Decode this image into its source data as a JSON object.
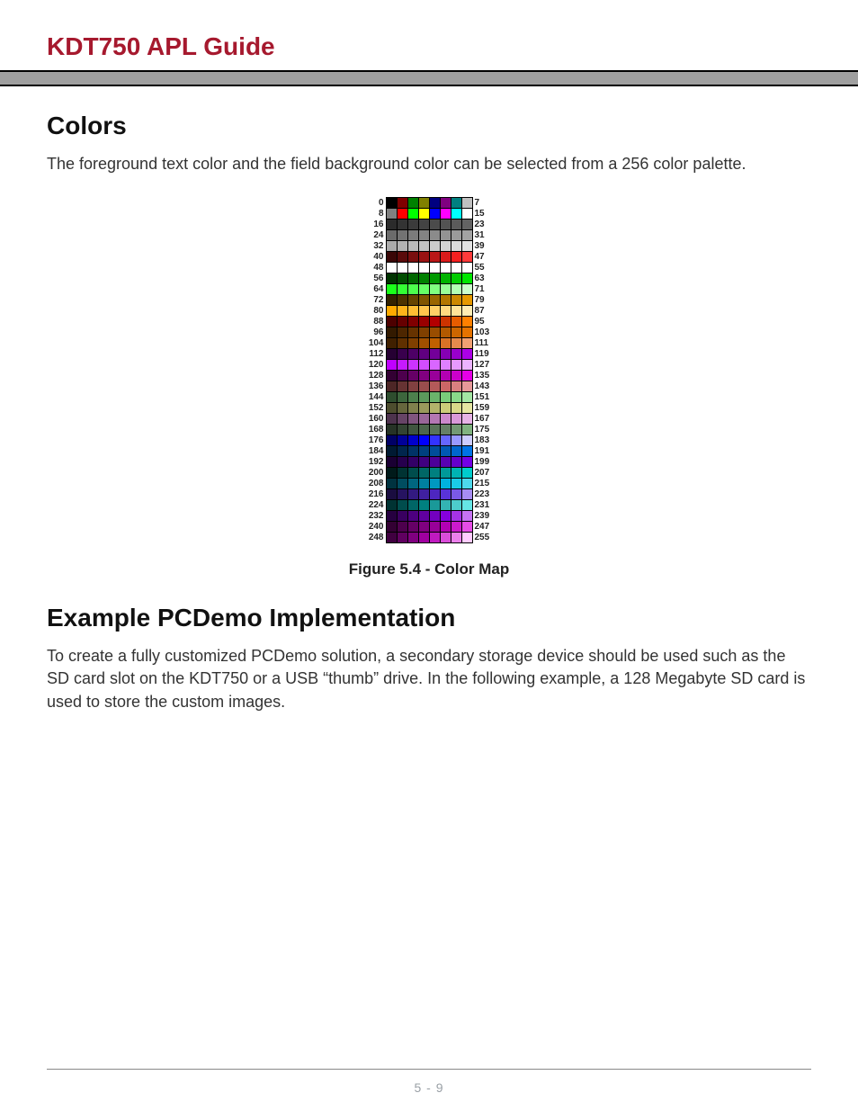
{
  "header": {
    "title": "KDT750 APL Guide"
  },
  "sections": {
    "colors": {
      "heading": "Colors",
      "paragraph": "The foreground text color and the field background color can be selected from a 256 color palette."
    },
    "example": {
      "heading": "Example PCDemo Implementation",
      "paragraph": "To create a fully customized PCDemo solution, a secondary storage device should be used such as the SD card slot on the KDT750 or a USB “thumb” drive. In the following example, a 128 Megabyte SD card is used to store the custom images."
    }
  },
  "figure": {
    "caption": "Figure 5.4 - Color Map",
    "left_labels": [
      "0",
      "8",
      "16",
      "24",
      "32",
      "40",
      "48",
      "56",
      "64",
      "72",
      "80",
      "88",
      "96",
      "104",
      "112",
      "120",
      "128",
      "136",
      "144",
      "152",
      "160",
      "168",
      "176",
      "184",
      "192",
      "200",
      "208",
      "216",
      "224",
      "232",
      "240",
      "248"
    ],
    "right_labels": [
      "7",
      "15",
      "23",
      "31",
      "39",
      "47",
      "55",
      "63",
      "71",
      "79",
      "87",
      "95",
      "103",
      "111",
      "119",
      "127",
      "135",
      "143",
      "151",
      "159",
      "167",
      "175",
      "183",
      "191",
      "199",
      "207",
      "215",
      "223",
      "231",
      "239",
      "247",
      "255"
    ],
    "rows": [
      [
        "#000000",
        "#800000",
        "#008000",
        "#808000",
        "#000080",
        "#800080",
        "#008080",
        "#c0c0c0"
      ],
      [
        "#808080",
        "#ff0000",
        "#00ff00",
        "#ffff00",
        "#0000ff",
        "#ff00ff",
        "#00ffff",
        "#ffffff"
      ],
      [
        "#2b2b2b",
        "#333333",
        "#3b3b3b",
        "#434343",
        "#4b4b4b",
        "#535353",
        "#5b5b5b",
        "#636363"
      ],
      [
        "#6b6b6b",
        "#737373",
        "#7b7b7b",
        "#838383",
        "#8b8b8b",
        "#939393",
        "#9b9b9b",
        "#a3a3a3"
      ],
      [
        "#ababab",
        "#b3b3b3",
        "#bbbbbb",
        "#c3c3c3",
        "#cbcbcb",
        "#d3d3d3",
        "#dbdbdb",
        "#e3e3e3"
      ],
      [
        "#3a0707",
        "#5a0b0b",
        "#7a0f0f",
        "#9a1313",
        "#ba1717",
        "#da1b1b",
        "#f52020",
        "#ff3a3a"
      ],
      [
        "#ffffff",
        "#ffffff",
        "#ffffff",
        "#ffffff",
        "#ffffff",
        "#ffffff",
        "#ffffff",
        "#ffffff"
      ],
      [
        "#003300",
        "#004d00",
        "#006600",
        "#008000",
        "#009900",
        "#00b300",
        "#00cc00",
        "#00e600"
      ],
      [
        "#1aff1a",
        "#33ff33",
        "#4dff4d",
        "#66ff66",
        "#80ff80",
        "#99ff99",
        "#b3ffb3",
        "#ccffcc"
      ],
      [
        "#332200",
        "#4d3300",
        "#664400",
        "#805500",
        "#996600",
        "#b37700",
        "#cc8800",
        "#e69900"
      ],
      [
        "#ffaa00",
        "#ffb31a",
        "#ffbd33",
        "#ffc64d",
        "#ffd066",
        "#ffd980",
        "#ffe399",
        "#ffecb3"
      ],
      [
        "#4d0000",
        "#660000",
        "#800000",
        "#990000",
        "#b30000",
        "#cc3300",
        "#e65c00",
        "#ff8000"
      ],
      [
        "#331a00",
        "#4d2600",
        "#663300",
        "#804000",
        "#994d00",
        "#b35900",
        "#cc6600",
        "#e67300"
      ],
      [
        "#402000",
        "#603000",
        "#804000",
        "#a05000",
        "#c06000",
        "#d97326",
        "#e68a4d",
        "#f2a173"
      ],
      [
        "#260033",
        "#39004d",
        "#4d0066",
        "#600080",
        "#730099",
        "#8600b3",
        "#9900cc",
        "#ac00e6"
      ],
      [
        "#bf00ff",
        "#c61aff",
        "#cc33ff",
        "#d24dff",
        "#d966ff",
        "#df80ff",
        "#e699ff",
        "#ecb3ff"
      ],
      [
        "#330033",
        "#4d004d",
        "#660066",
        "#800080",
        "#990099",
        "#b300b3",
        "#cc00cc",
        "#e600e6"
      ],
      [
        "#4d2626",
        "#663333",
        "#804040",
        "#994d4d",
        "#b35959",
        "#cc6666",
        "#d98080",
        "#e69999"
      ],
      [
        "#2e4d2e",
        "#3d663d",
        "#4d804d",
        "#5c995c",
        "#6bb36b",
        "#7acc7a",
        "#8ad98a",
        "#a3e6a3"
      ],
      [
        "#4d4d2e",
        "#66663d",
        "#80804d",
        "#99995c",
        "#b3b36b",
        "#cccc7a",
        "#d9d98a",
        "#e6e6a3"
      ],
      [
        "#4d334d",
        "#664466",
        "#805580",
        "#996699",
        "#b377b3",
        "#cc88cc",
        "#d999d9",
        "#e6b3e6"
      ],
      [
        "#263326",
        "#334433",
        "#405540",
        "#4d664d",
        "#597359",
        "#668066",
        "#739973",
        "#80b380"
      ],
      [
        "#000066",
        "#000099",
        "#0000cc",
        "#0000ff",
        "#3333ff",
        "#6666ff",
        "#9999ff",
        "#ccccff"
      ],
      [
        "#001a33",
        "#00264d",
        "#003366",
        "#004080",
        "#004d99",
        "#0059b3",
        "#0066cc",
        "#0073e6"
      ],
      [
        "#1a0033",
        "#26004d",
        "#330066",
        "#400080",
        "#4d0099",
        "#5900b3",
        "#6600cc",
        "#7300e6"
      ],
      [
        "#001a1a",
        "#003333",
        "#004d4d",
        "#006666",
        "#008080",
        "#009999",
        "#00b3b3",
        "#00cccc"
      ],
      [
        "#003340",
        "#004d60",
        "#006680",
        "#0080a0",
        "#0099c0",
        "#00b3df",
        "#1acce6",
        "#4dd9ec"
      ],
      [
        "#1a0d40",
        "#261360",
        "#331a80",
        "#4020a0",
        "#4d26c0",
        "#5933d9",
        "#7a59e6",
        "#a68cf2"
      ],
      [
        "#003333",
        "#004d4d",
        "#006666",
        "#008080",
        "#1a9999",
        "#33b3b3",
        "#4dcccc",
        "#66e6e6"
      ],
      [
        "#260040",
        "#390060",
        "#4d0080",
        "#6000a0",
        "#7300c0",
        "#8600df",
        "#a633e6",
        "#c673f2"
      ],
      [
        "#330033",
        "#4d004d",
        "#660066",
        "#800080",
        "#990099",
        "#b300b3",
        "#cc1acc",
        "#e64de6"
      ],
      [
        "#400040",
        "#600060",
        "#800080",
        "#a000a0",
        "#c01ac0",
        "#d94dd9",
        "#ec80ec",
        "#ffccff"
      ]
    ]
  },
  "footer": {
    "page": "5 - 9"
  }
}
